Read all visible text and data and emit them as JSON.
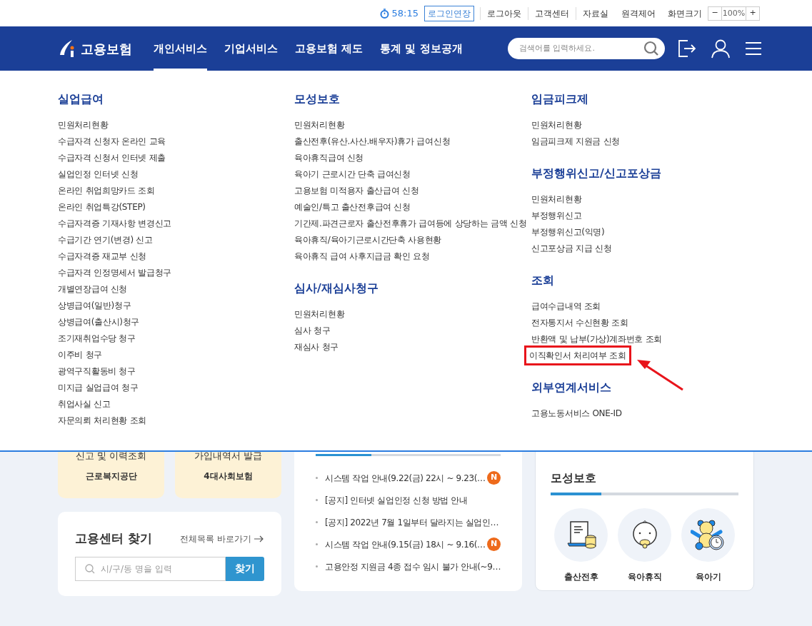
{
  "utility_bar": {
    "timer": "58:15",
    "extend_button": "로그인연장",
    "links": [
      "로그아웃",
      "고객센터",
      "자료실",
      "원격제어"
    ],
    "zoom_label": "화면크기",
    "zoom_minus": "−",
    "zoom_value": "100%",
    "zoom_plus": "+"
  },
  "nav": {
    "logo": "고용보험",
    "items": [
      {
        "label": "개인서비스",
        "selected": true
      },
      {
        "label": "기업서비스",
        "selected": false
      },
      {
        "label": "고용보험 제도",
        "selected": false
      },
      {
        "label": "통계 및 정보공개",
        "selected": false
      }
    ],
    "search": {
      "placeholder": "검색어를 입력하세요."
    }
  },
  "mega_menu": {
    "columns": [
      {
        "sections": [
          {
            "title": "실업급여",
            "items": [
              {
                "label": "민원처리현황",
                "highlighted": false
              },
              {
                "label": "수급자격 신청자 온라인 교육",
                "highlighted": false
              },
              {
                "label": "수급자격 신청서 인터넷 제출",
                "highlighted": false
              },
              {
                "label": "실업인정 인터넷 신청",
                "highlighted": false
              },
              {
                "label": "온라인 취업희망카드 조회",
                "highlighted": false
              },
              {
                "label": "온라인 취업특강(STEP)",
                "highlighted": false
              },
              {
                "label": "수급자격증 기재사항 변경신고",
                "highlighted": false
              },
              {
                "label": "수급기간 연기(변경) 신고",
                "highlighted": false
              },
              {
                "label": "수급자격증 재교부 신청",
                "highlighted": false
              },
              {
                "label": "수급자격 인정명세서 발급청구",
                "highlighted": false
              },
              {
                "label": "개별연장급여 신청",
                "highlighted": false
              },
              {
                "label": "상병급여(일반)청구",
                "highlighted": false
              },
              {
                "label": "상병급여(출산시)청구",
                "highlighted": false
              },
              {
                "label": "조기재취업수당 청구",
                "highlighted": false
              },
              {
                "label": "이주비 청구",
                "highlighted": false
              },
              {
                "label": "광역구직활동비 청구",
                "highlighted": false
              },
              {
                "label": "미지급 실업급여 청구",
                "highlighted": false
              },
              {
                "label": "취업사실 신고",
                "highlighted": false
              },
              {
                "label": "자문의뢰 처리현황 조회",
                "highlighted": false
              }
            ]
          }
        ]
      },
      {
        "sections": [
          {
            "title": "모성보호",
            "items": [
              {
                "label": "민원처리현황",
                "highlighted": false
              },
              {
                "label": "출산전후(유산.사산.배우자)휴가 급여신청",
                "highlighted": false
              },
              {
                "label": "육아휴직급여 신청",
                "highlighted": false
              },
              {
                "label": "육아기 근로시간 단축 급여신청",
                "highlighted": false
              },
              {
                "label": "고용보험 미적용자 출산급여 신청",
                "highlighted": false
              },
              {
                "label": "예술인/특고 출산전후급여 신청",
                "highlighted": false
              },
              {
                "label": "기간제.파견근로자 출산전후휴가 급여등에 상당하는 금액 신청",
                "highlighted": false
              },
              {
                "label": "육아휴직/육아기근로시간단축 사용현황",
                "highlighted": false
              },
              {
                "label": "육아휴직 급여 사후지급금 확인 요청",
                "highlighted": false
              }
            ]
          },
          {
            "title": "심사/재심사청구",
            "items": [
              {
                "label": "민원처리현황",
                "highlighted": false
              },
              {
                "label": "심사 청구",
                "highlighted": false
              },
              {
                "label": "재심사 청구",
                "highlighted": false
              }
            ]
          }
        ]
      },
      {
        "sections": [
          {
            "title": "임금피크제",
            "items": [
              {
                "label": "민원처리현황",
                "highlighted": false
              },
              {
                "label": "임금피크제 지원금 신청",
                "highlighted": false
              }
            ]
          },
          {
            "title": "부정행위신고/신고포상금",
            "items": [
              {
                "label": "민원처리현황",
                "highlighted": false
              },
              {
                "label": "부정행위신고",
                "highlighted": false
              },
              {
                "label": "부정행위신고(익명)",
                "highlighted": false
              },
              {
                "label": "신고포상금 지급 신청",
                "highlighted": false
              }
            ]
          },
          {
            "title": "조회",
            "items": [
              {
                "label": "급여수급내역 조회",
                "highlighted": false
              },
              {
                "label": "전자통지서 수신현황 조회",
                "highlighted": false
              },
              {
                "label": "반환액 및 납부(가상)계좌번호 조회",
                "highlighted": false
              },
              {
                "label": "이직확인서 처리여부 조회",
                "highlighted": true
              }
            ]
          },
          {
            "title": "외부연계서비스",
            "items": [
              {
                "label": "고용노동서비스 ONE-ID",
                "highlighted": false
              }
            ]
          }
        ]
      }
    ]
  },
  "quick_cards": [
    {
      "label": "신고 및 이력조회",
      "org": "근로복지공단"
    },
    {
      "label": "가입내역서 발급",
      "org": "4대사회보험"
    }
  ],
  "center_finder": {
    "title": "고용센터 찾기",
    "link": "전체목록 바로가기",
    "search": {
      "placeholder": "시/구/동 명을 입력"
    },
    "button": "찾기"
  },
  "notices": {
    "progress": {
      "level": 0.3
    },
    "items": [
      {
        "text": "시스템 작업 안내(9.22(금) 22시 ~ 9.23(…",
        "new": true,
        "badge": "N"
      },
      {
        "text": "[공지] 인터넷 실업인정 신청 방법 안내",
        "new": false
      },
      {
        "text": "[공지] 2022년 7월 1일부터 달라지는 실업인…",
        "new": false
      },
      {
        "text": "시스템 작업 안내(9.15(금) 18시 ~ 9.16(…",
        "new": true,
        "badge": "N"
      },
      {
        "text": "고용안정 지원금 4종 접수 임시 불가 안내(~9…",
        "new": false
      }
    ]
  },
  "maternity": {
    "title": "모성보호",
    "progress": {
      "level": 0.27
    },
    "items": [
      {
        "label": "출산전후",
        "kind": "document"
      },
      {
        "label": "육아휴직",
        "kind": "baby"
      },
      {
        "label": "육아기",
        "kind": "bear"
      }
    ]
  }
}
